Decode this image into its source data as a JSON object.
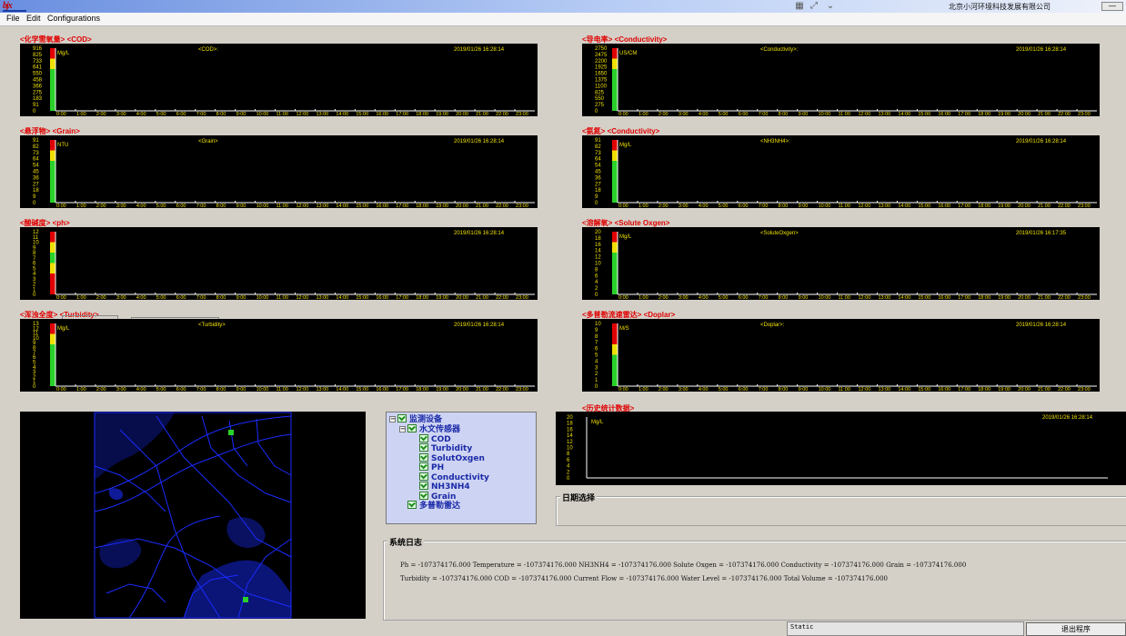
{
  "titlebar": {
    "logo_text": "bjx",
    "company": "北京小河环境科技发展有限公司",
    "minimize_label": "—"
  },
  "menu": [
    "File",
    "Edit",
    "Configurations"
  ],
  "time_ticks": [
    "0:00",
    "1:00",
    "2:00",
    "3:00",
    "4:00",
    "5:00",
    "6:00",
    "7:00",
    "8:00",
    "9:00",
    "10:00",
    "11:00",
    "12:00",
    "13:00",
    "14:00",
    "15:00",
    "16:00",
    "17:00",
    "18:00",
    "19:00",
    "20:00",
    "21:00",
    "22:00",
    "23:00"
  ],
  "charts": [
    {
      "title": "<化学需氧量> <COD>",
      "label": "<COD>:",
      "timestamp": "2019/01/26  16:28:14",
      "unit": "Mg/L",
      "yticks": [
        "916",
        "825",
        "733",
        "641",
        "550",
        "458",
        "366",
        "275",
        "183",
        "91",
        "0"
      ],
      "gauge": [
        [
          "#e00000",
          1
        ],
        [
          "#f0e000",
          1
        ],
        [
          "#2ad12a",
          4
        ]
      ],
      "axis": "x"
    },
    {
      "title": "<导电率> <Conductivity>",
      "label": "<Conductivity>:",
      "timestamp": "2019/01/26  16:28:14",
      "unit": "US/CM",
      "yticks": [
        "2750",
        "2475",
        "2200",
        "1925",
        "1650",
        "1375",
        "1100",
        "825",
        "550",
        "275",
        "0"
      ],
      "gauge": [
        [
          "#e00000",
          1
        ],
        [
          "#f0e000",
          1
        ],
        [
          "#2ad12a",
          4
        ]
      ],
      "axis": "x"
    },
    {
      "title": "<悬浮物> <Grain>",
      "label": "<Grain>",
      "timestamp": "2019/01/26  16:28:14",
      "unit": "NTU",
      "yticks": [
        "91",
        "82",
        "73",
        "64",
        "54",
        "45",
        "36",
        "27",
        "18",
        "9",
        "0"
      ],
      "gauge": [
        [
          "#e00000",
          1
        ],
        [
          "#f0e000",
          1
        ],
        [
          "#2ad12a",
          4
        ]
      ],
      "axis": "x"
    },
    {
      "title": "<氨氮> <Conductivity>",
      "label": "<NH3NH4>:",
      "timestamp": "2019/01/26  16:28:14",
      "unit": "Mg/L",
      "yticks": [
        "91",
        "82",
        "73",
        "64",
        "54",
        "45",
        "36",
        "27",
        "18",
        "9",
        "0"
      ],
      "gauge": [
        [
          "#e00000",
          1
        ],
        [
          "#f0e000",
          1
        ],
        [
          "#2ad12a",
          4
        ]
      ],
      "axis": "x"
    },
    {
      "title": "<酸碱度> <ph>",
      "label": "",
      "timestamp": "2019/01/26  16:28:14",
      "unit": "",
      "yticks": [
        "12",
        "11",
        "10",
        "9",
        "8",
        "7",
        "6",
        "5",
        "4",
        "3",
        "2",
        "1",
        "0"
      ],
      "gauge": [
        [
          "#e00000",
          1
        ],
        [
          "#f0e000",
          1
        ],
        [
          "#2ad12a",
          1
        ],
        [
          "#f0e000",
          1
        ],
        [
          "#e00000",
          2
        ]
      ],
      "axis": "x"
    },
    {
      "title": "<溶解氧> <Solute Oxgen>",
      "label": "<SoluteOxgen>",
      "timestamp": "2019/01/26  16:17:35",
      "unit": "Mg/L",
      "yticks": [
        "20",
        "18",
        "16",
        "14",
        "12",
        "10",
        "8",
        "6",
        "4",
        "2",
        "0"
      ],
      "gauge": [
        [
          "#e00000",
          1
        ],
        [
          "#f0e000",
          1
        ],
        [
          "#2ad12a",
          4
        ]
      ],
      "axis": "x"
    },
    {
      "title": "<浑浊全度> <Turbidity>",
      "label": "<Turbidity>",
      "timestamp": "2019/01/26  16:28:14",
      "unit": "Mg/L",
      "yticks": [
        "13",
        "12",
        "11",
        "10",
        "9",
        "8",
        "7",
        "6",
        "5",
        "4",
        "3",
        "2",
        "1",
        "0"
      ],
      "gauge": [
        [
          "#e00000",
          1
        ],
        [
          "#f0e000",
          1
        ],
        [
          "#2ad12a",
          4
        ]
      ],
      "axis": "x"
    },
    {
      "title": "<多普勒流速雷达> <Doplar>",
      "label": "<Doplar>:",
      "timestamp": "2019/01/26  16:28:14",
      "unit": "M/S",
      "yticks": [
        "10",
        "9",
        "8",
        "7",
        "6",
        "5",
        "4",
        "3",
        "2",
        "1",
        "0"
      ],
      "gauge": [
        [
          "#e00000",
          2
        ],
        [
          "#f0e000",
          1
        ],
        [
          "#2ad12a",
          3
        ]
      ],
      "axis": "x"
    }
  ],
  "history": {
    "title": "<历史统计数据>",
    "timestamp": "2019/01/26  16:28:14",
    "unit": "Mg/L",
    "yticks": [
      "20",
      "18",
      "16",
      "14",
      "12",
      "10",
      "8",
      "6",
      "4",
      "2",
      "0"
    ]
  },
  "tree": {
    "root": "监测设备",
    "group": "水文传感器",
    "children": [
      "COD",
      "Turbidity",
      "SolutOxgen",
      "PH",
      "Conductivity",
      "NH3NH4",
      "Grain"
    ],
    "sibling": "多普勒雷达"
  },
  "date_select": {
    "label": "日期选择"
  },
  "syslog": {
    "label": "系统日志",
    "lines": [
      "Ph = -107374176.000   Temperature = -107374176.000   NH3NH4 = -107374176.000   Solute Oxgen = -107374176.000   Conductivity = -107374176.000   Grain = -107374176.000",
      "Turbidity = -107374176.000   COD = -107374176.000   Current Flow = -107374176.000   Water Level = -107374176.000   Total Volume = -107374176.000"
    ]
  },
  "status": {
    "text": "Static"
  },
  "exit_label": "退出程序",
  "colors": {
    "chart_bg": "#000000",
    "axis": "#ffffff",
    "tick_text": "#f0e000",
    "title_red": "#e00000",
    "map_lines": "#1a2cff",
    "marker": "#2ad12a"
  }
}
